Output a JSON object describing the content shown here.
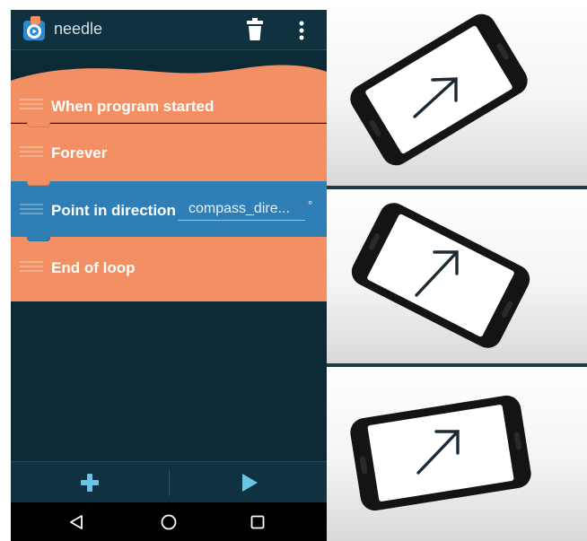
{
  "app": {
    "title": "needle",
    "icons": [
      "app-logo-icon",
      "trash-icon",
      "overflow-menu-icon"
    ]
  },
  "script": {
    "bricks": [
      {
        "label": "When program started",
        "color": "#f29063",
        "type": "event"
      },
      {
        "label": "Forever",
        "color": "#f29063",
        "type": "control"
      },
      {
        "label": "Point in direction",
        "color": "#2f7eb6",
        "type": "motion",
        "field_value": "compass_dire...",
        "unit": "°"
      },
      {
        "label": "End of loop",
        "color": "#f29063",
        "type": "control"
      }
    ]
  },
  "bottom_bar": {
    "icons": [
      "add-icon",
      "play-icon"
    ]
  },
  "nav_bar": {
    "icons": [
      "back-icon",
      "home-icon",
      "recents-icon"
    ]
  },
  "illustration": {
    "panels": 3,
    "icons": [
      "phone-with-arrow-icon"
    ]
  },
  "colors": {
    "background": "#0b2a36",
    "bar": "#0f3140",
    "orange_brick": "#f29063",
    "blue_brick": "#2f7eb6",
    "accent": "#6cc3e8"
  }
}
